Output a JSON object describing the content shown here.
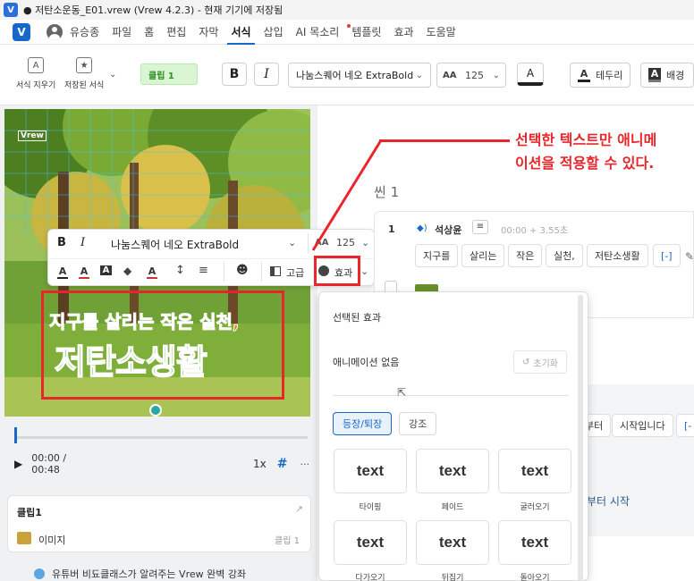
{
  "window": {
    "title": "● 저탄소운동_E01.vrew (Vrew 4.2.3) - 현재 기기에 저장됨"
  },
  "menu": {
    "user": "유승종",
    "items": [
      "파일",
      "홈",
      "편집",
      "자막",
      "서식",
      "삽입",
      "AI 목소리",
      "템플릿",
      "효과",
      "도움말"
    ],
    "active": "서식"
  },
  "toolbar": {
    "clear_format": "서식 지우기",
    "saved_format": "저장된 서식",
    "clip_chip": "클립 1",
    "bold": "B",
    "italic": "I",
    "font": "나눔스퀘어 네오 ExtraBold",
    "size": "125",
    "outline": "테두리",
    "background": "배경"
  },
  "floating_toolbar": {
    "bold": "B",
    "italic": "I",
    "font": "나눔스퀘어 네오 ExtraBold",
    "size": "125",
    "advanced": "고급",
    "effect": "효과"
  },
  "video": {
    "watermark": "Vrew",
    "caption_line1": "지구를 살리는 작은 실천,",
    "caption_line2": "저탄소생활"
  },
  "player": {
    "time": "00:00 / 00:48",
    "speed": "1x"
  },
  "clip_card": {
    "title": "클립1",
    "type": "이미지",
    "clip_ref": "클립 1"
  },
  "tip": "유튜버 비됴클래스가 알려주는 Vrew 완벽 강좌",
  "scene": {
    "label": "씬 1",
    "row_num": "1",
    "speaker": "석상윤",
    "timing": "00:00 + 3.55초",
    "words": [
      "지구를",
      "살리는",
      "작은",
      "실천,",
      "저탄소생활",
      "[-]"
    ],
    "row2_words": [
      "부터",
      "시작입니다",
      "[-"
    ],
    "row2_text": "부터 시작"
  },
  "annotation": {
    "line1": "선택한 텍스트만 애니메",
    "line2": "이션을 적용할 수 있다."
  },
  "effects_popup": {
    "title": "선택된 효과",
    "current": "애니메이션 없음",
    "reset": "초기화",
    "tabs": [
      "등장/퇴장",
      "강조"
    ],
    "cards": [
      {
        "sample": "text",
        "label": "타이핑"
      },
      {
        "sample": "text",
        "label": "페이드"
      },
      {
        "sample": "text",
        "label": "굴러오기"
      },
      {
        "sample": "text",
        "label": "다가오기"
      },
      {
        "sample": "text",
        "label": "뒤집기"
      },
      {
        "sample": "text",
        "label": "돌아오기"
      }
    ]
  },
  "colors": {
    "accent": "#1769c8",
    "annotation_red": "#e8262b",
    "clip_green": "#2f8f23",
    "caption_orange": "#f07a1a",
    "caption_green": "#3aaa2a"
  }
}
